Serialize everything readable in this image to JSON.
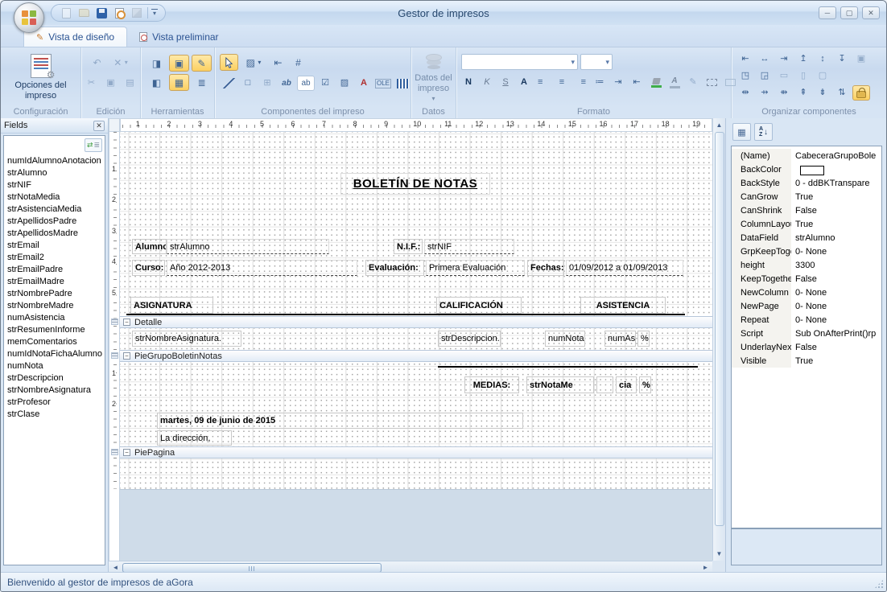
{
  "window": {
    "title": "Gestor de impresos",
    "status": "Bienvenido al gestor de impresos de aGora"
  },
  "icons": {
    "caret": "▾",
    "caret_up": "▲",
    "caret_down": "▼",
    "caret_left": "◄",
    "caret_right": "►",
    "min": "─",
    "max": "▢",
    "close": "✕",
    "gear": "⚙",
    "minus": "−",
    "undo": "↶",
    "delete_x": "✕",
    "cut": "✂",
    "copy": "▣",
    "paste": "▤",
    "tool_page_panel": "◨",
    "tool_page_center": "▣",
    "tool_edit": "✎",
    "tool_panel_blue": "◧",
    "tool_grid": "▦",
    "tool_outline": "≣",
    "image_tool": "▨",
    "indent_tool": "⇤",
    "pagenum_tool": "#",
    "rect_tool": "□",
    "table_tool": "⊞",
    "check_tool": "☑",
    "rich_a": "A",
    "align": "≡",
    "list": "≔",
    "indent": "⇥",
    "outdent": "⇤",
    "sort_a": "A",
    "sort_z": "Z",
    "arrow_down": "↓",
    "refresh_arrows": "⇄",
    "refresh_lines": "≣",
    "tab_design": "✎",
    "org1": [
      "⇤",
      "↔",
      "⇥",
      "↥",
      "↕",
      "↧",
      "▣"
    ],
    "org2": [
      "◳",
      "◲",
      "▭",
      "▯",
      "▢"
    ],
    "org3": [
      "⇹",
      "⇸",
      "⇻",
      "⇞",
      "⇟",
      "⇅"
    ]
  },
  "tabs": [
    {
      "label": "Vista de diseño"
    },
    {
      "label": "Vista preliminar"
    }
  ],
  "ribbon": {
    "configuracion": {
      "label": "Configuración",
      "button": "Opciones del impreso"
    },
    "edicion": {
      "label": "Edición"
    },
    "herramientas": {
      "label": "Herramientas"
    },
    "componentes": {
      "label": "Componentes del impreso",
      "ab": "ab",
      "ab2": "ab",
      "ole": "OLE"
    },
    "datos": {
      "label": "Datos",
      "button": "Datos del impreso"
    },
    "formato": {
      "label": "Formato",
      "bold": "N",
      "italic": "K",
      "underline": "S",
      "color_a": "A"
    },
    "organizar": {
      "label": "Organizar componentes"
    }
  },
  "fields_panel": {
    "title": "Fields",
    "items": [
      "numIdAlumnoAnotacion",
      "strAlumno",
      "strNIF",
      "strNotaMedia",
      "strAsistenciaMedia",
      "strApellidosPadre",
      "strApellidosMadre",
      "strEmail",
      "strEmail2",
      "strEmailPadre",
      "strEmailMadre",
      "strNombrePadre",
      "strNombreMadre",
      "numAsistencia",
      "strResumenInforme",
      "memComentarios",
      "numIdNotaFichaAlumno",
      "numNota",
      "strDescripcion",
      "strNombreAsignatura",
      "strProfesor",
      "strClase"
    ]
  },
  "designer": {
    "hruler": [
      "1",
      "2",
      "3",
      "4",
      "5",
      "6",
      "7",
      "8",
      "9",
      "10",
      "11",
      "12",
      "13",
      "14",
      "15",
      "16",
      "17",
      "18",
      "19"
    ],
    "vruler": [
      "1",
      "2",
      "3",
      "4",
      "5",
      "1",
      "2"
    ],
    "sections": {
      "detalle": "Detalle",
      "pie_grupo": "PieGrupoBoletinNotas",
      "pie_pagina": "PiePagina"
    },
    "report": {
      "title": "BOLETÍN DE NOTAS",
      "alumno_label": "Alumno:",
      "alumno_field": "strAlumno",
      "nif_label": "N.I.F.:",
      "nif_field": "strNIF",
      "curso_label": "Curso:",
      "curso_field": "Año 2012-2013",
      "evaluacion_label": "Evaluación:",
      "evaluacion_field": "Primera Evaluación",
      "fechas_label": "Fechas:",
      "fechas_field": "01/09/2012 a 01/09/2013",
      "col_asignatura": "ASIGNATURA",
      "col_calificacion": "CALIFICACIÓN",
      "col_asistencia": "ASISTENCIA",
      "det_asignatura": "strNombreAsignatura.",
      "det_descripcion": "strDescripcion.",
      "det_nota": "numNota.",
      "det_asistencia": "numAs",
      "det_pct": "%",
      "medias_label": "MEDIAS:",
      "medias_nota": "strNotaMe",
      "medias_cia": "cia",
      "medias_pct": "%",
      "fecha_pie": "martes, 09 de junio de 2015",
      "direccion": "La dirección,"
    }
  },
  "properties": {
    "rows": [
      {
        "name": "(Name)",
        "value": "CabeceraGrupoBole"
      },
      {
        "name": "BackColor",
        "value": ""
      },
      {
        "name": "BackStyle",
        "value": "0 - ddBKTranspare"
      },
      {
        "name": "CanGrow",
        "value": "True"
      },
      {
        "name": "CanShrink",
        "value": "False"
      },
      {
        "name": "ColumnLayou",
        "value": "True"
      },
      {
        "name": "DataField",
        "value": "strAlumno"
      },
      {
        "name": "GrpKeepToge",
        "value": "0- None"
      },
      {
        "name": "height",
        "value": "3300"
      },
      {
        "name": "KeepTogethe",
        "value": "False"
      },
      {
        "name": "NewColumn",
        "value": "0- None"
      },
      {
        "name": "NewPage",
        "value": "0- None"
      },
      {
        "name": "Repeat",
        "value": "0- None"
      },
      {
        "name": "Script",
        "value": "Sub OnAfterPrint()rp"
      },
      {
        "name": "UnderlayNext",
        "value": "False"
      },
      {
        "name": "Visible",
        "value": "True"
      }
    ]
  }
}
